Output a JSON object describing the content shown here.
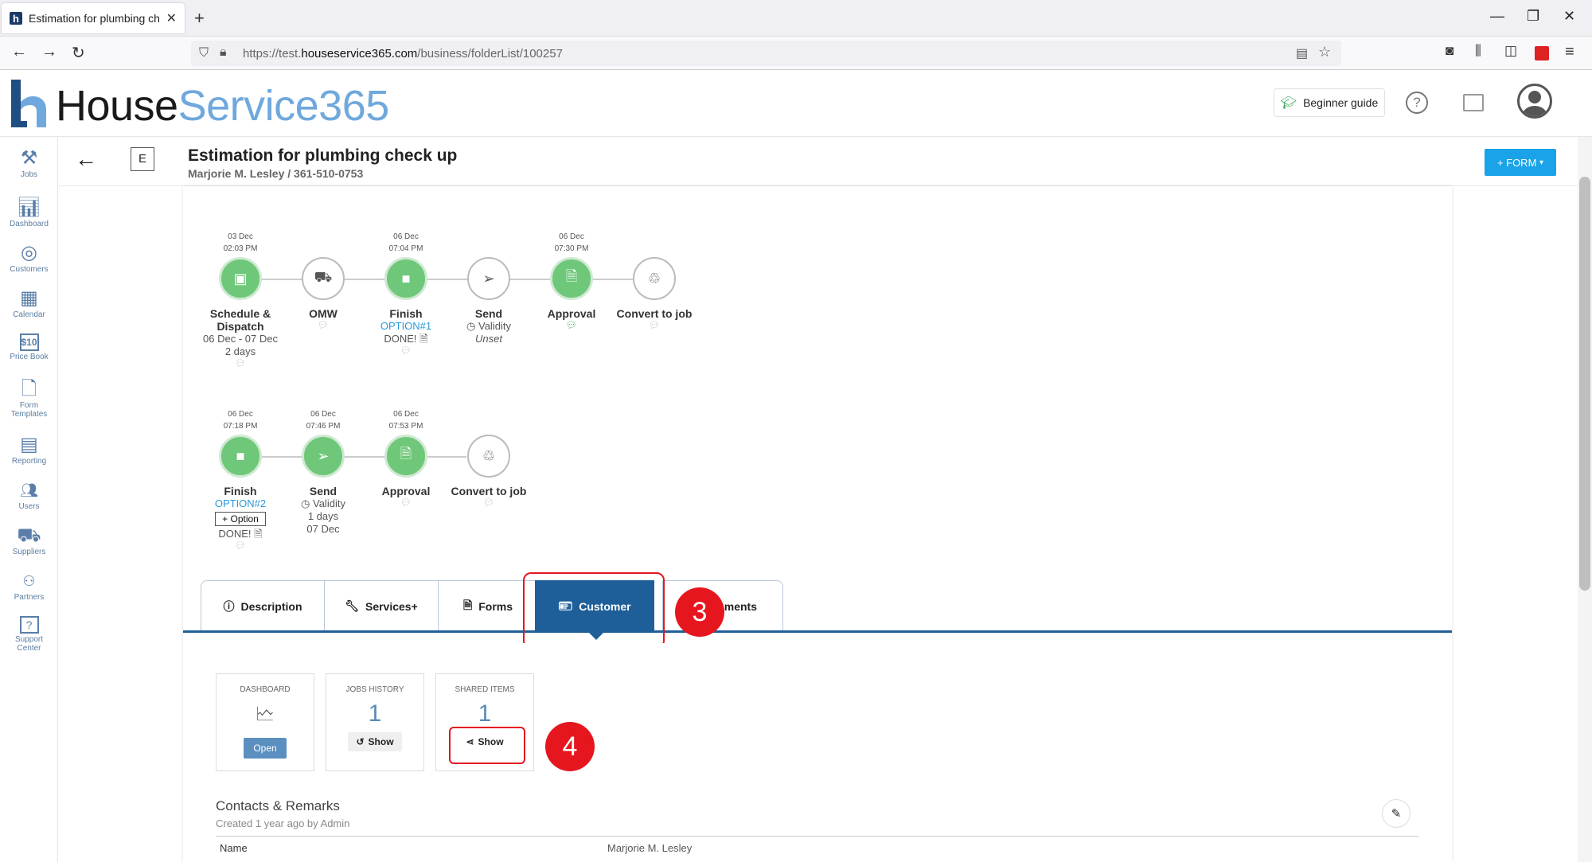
{
  "browser": {
    "tab_title": "Estimation for plumbing check up",
    "url_prefix": "https://test.",
    "url_domain": "houseservice365.com",
    "url_path": "/business/folderList/100257"
  },
  "header": {
    "logo_part1": "House",
    "logo_part2": "Service365",
    "beginner_guide": "Beginner guide",
    "help": "?"
  },
  "sidebar": {
    "items": [
      {
        "label": "Jobs",
        "icon": "tools-icon"
      },
      {
        "label": "Dashboard",
        "icon": "chart-icon"
      },
      {
        "label": "Customers",
        "icon": "target-icon"
      },
      {
        "label": "Calendar",
        "icon": "calendar-icon"
      },
      {
        "label": "Price Book",
        "icon": "price-tag-icon"
      },
      {
        "label": "Form",
        "label2": "Templates",
        "icon": "form-icon"
      },
      {
        "label": "Reporting",
        "icon": "report-icon"
      },
      {
        "label": "Users",
        "icon": "users-icon"
      },
      {
        "label": "Suppliers",
        "icon": "truck-icon"
      },
      {
        "label": "Partners",
        "icon": "partners-icon"
      },
      {
        "label": "Support",
        "label2": "Center",
        "icon": "support-icon"
      }
    ]
  },
  "page": {
    "badge": "E",
    "title": "Estimation for plumbing check up",
    "subtitle": "Marjorie M. Lesley / 361-510-0753",
    "form_button": "+ FORM"
  },
  "timeline_row1": [
    {
      "date": "03 Dec",
      "time": "02:03 PM",
      "label": "Schedule &",
      "label2": "Dispatch",
      "sub1": "06 Dec - 07 Dec",
      "sub2": "2 days"
    },
    {
      "date": "",
      "time": "",
      "label": "OMW"
    },
    {
      "date": "06 Dec",
      "time": "07:04 PM",
      "label": "Finish",
      "option": "OPTION#1",
      "done": "DONE!"
    },
    {
      "date": "",
      "time": "",
      "label": "Send",
      "validity": "Validity",
      "unset": "Unset"
    },
    {
      "date": "06 Dec",
      "time": "07:30 PM",
      "label": "Approval"
    },
    {
      "date": "",
      "time": "",
      "label": "Convert to job"
    }
  ],
  "timeline_row2": [
    {
      "date": "06 Dec",
      "time": "07:18 PM",
      "label": "Finish",
      "option": "OPTION#2",
      "add_option": "+ Option",
      "done": "DONE!"
    },
    {
      "date": "06 Dec",
      "time": "07:46 PM",
      "label": "Send",
      "validity": "Validity",
      "sub1": "1 days",
      "sub2": "07 Dec"
    },
    {
      "date": "06 Dec",
      "time": "07:53 PM",
      "label": "Approval"
    },
    {
      "date": "",
      "time": "",
      "label": "Convert to job"
    }
  ],
  "tabs": [
    {
      "label": "Description",
      "icon": "info-icon"
    },
    {
      "label": "Services+",
      "icon": "wrench-icon"
    },
    {
      "label": "Forms",
      "icon": "document-icon"
    },
    {
      "label": "Customer",
      "icon": "id-card-icon",
      "active": true
    },
    {
      "label": "ments",
      "icon": ""
    }
  ],
  "annotations": {
    "step3": "3",
    "step4": "4"
  },
  "stats": {
    "dashboard": {
      "title": "DASHBOARD",
      "button": "Open"
    },
    "jobs_history": {
      "title": "JOBS HISTORY",
      "count": "1",
      "button": "Show"
    },
    "shared_items": {
      "title": "SHARED ITEMS",
      "count": "1",
      "button": "Show"
    }
  },
  "contacts": {
    "title": "Contacts & Remarks",
    "created": "Created 1 year ago by Admin",
    "name_label": "Name",
    "name_value": "Marjorie M. Lesley"
  }
}
